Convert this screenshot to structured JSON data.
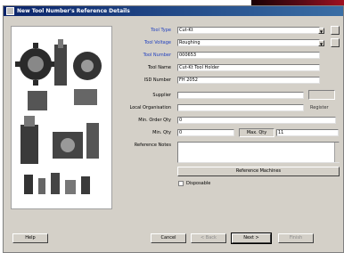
{
  "window": {
    "title": "New Tool Number's Reference Details"
  },
  "form": {
    "tool_type": {
      "label": "Tool Type",
      "value": "Cut-Kt"
    },
    "tool_voltage": {
      "label": "Tool Voltage",
      "value": "Roughing"
    },
    "tool_number": {
      "label": "Tool Number",
      "value": "000653"
    },
    "tool_name": {
      "label": "Tool Name",
      "value": "Cut-Kt Tool Holder"
    },
    "isd_number": {
      "label": "ISD Number",
      "value": "FH 2052"
    },
    "supplier": {
      "label": "Supplier",
      "value": ""
    },
    "local_organisation": {
      "label": "Local Organisation",
      "value": "",
      "side_label": "Register"
    },
    "min_order_qty": {
      "label": "Min. Order Qty",
      "value": "0"
    },
    "min_qty": {
      "label": "Min. Qty",
      "value": "0"
    },
    "max_qty": {
      "label": "Max. Qty",
      "value": "11"
    },
    "reference_notes": {
      "label": "Reference Notes",
      "value": ""
    },
    "reference_machines_label": "Reference Machines",
    "disposable": {
      "label": "Disposable",
      "checked": false
    }
  },
  "buttons": {
    "help": "Help",
    "cancel": "Cancel",
    "back": "< Back",
    "next": "Next >",
    "finish": "Finish"
  },
  "icons": {
    "dropdown": "chevron-down-icon",
    "side": "ellipsis-icon"
  },
  "colors": {
    "titlebar_start": "#0a246a",
    "titlebar_end": "#3a6ea5",
    "required_label": "#1f3fbf",
    "dialog_bg": "#d4d0c8"
  }
}
